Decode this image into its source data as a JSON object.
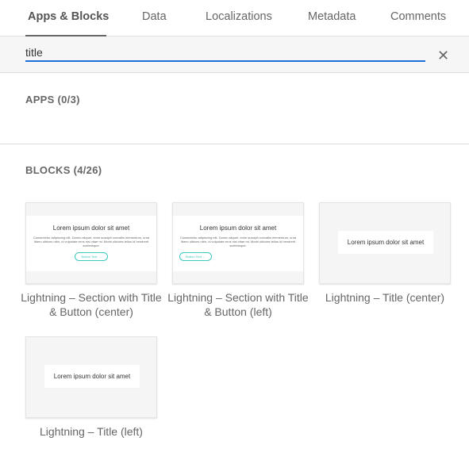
{
  "tabs": [
    {
      "label": "Apps & Blocks",
      "active": true
    },
    {
      "label": "Data"
    },
    {
      "label": "Localizations"
    },
    {
      "label": "Metadata"
    },
    {
      "label": "Comments"
    }
  ],
  "search": {
    "value": "title",
    "clear_icon": "close-icon",
    "accent": "#1a6ed8"
  },
  "apps": {
    "title": "APPS (0/3)"
  },
  "blocks": {
    "title": "BLOCKS (4/26)",
    "items": [
      {
        "label": "Lightning – Section with Title & Button (center)",
        "preview": {
          "title": "Lorem ipsum dolor sit amet",
          "body": "Consectetur adipiscing elit. Donec aliquet, enim suscipit convallis elementum, urna libero ultrices nibh, id vulputate eros nisi vitae mi. Morbi ultricies tellus id hendrerit scelerisque.",
          "button": "Button Text →"
        }
      },
      {
        "label": "Lightning – Section with Title & Button (left)",
        "preview": {
          "title": "Lorem ipsum dolor sit amet",
          "body": "Consectetur adipiscing elit. Donec aliquet, enim suscipit convallis elementum, urna libero ultrices nibh, id vulputate eros nisi vitae mi. Morbi ultricies tellus id hendrerit scelerisque.",
          "button": "Button Text →"
        }
      },
      {
        "label": "Lightning – Title (center)",
        "preview": {
          "title": "Lorem ipsum dolor sit amet"
        }
      },
      {
        "label": "Lightning – Title (left)",
        "preview": {
          "title": "Lorem ipsum dolor sit amet"
        }
      }
    ]
  }
}
